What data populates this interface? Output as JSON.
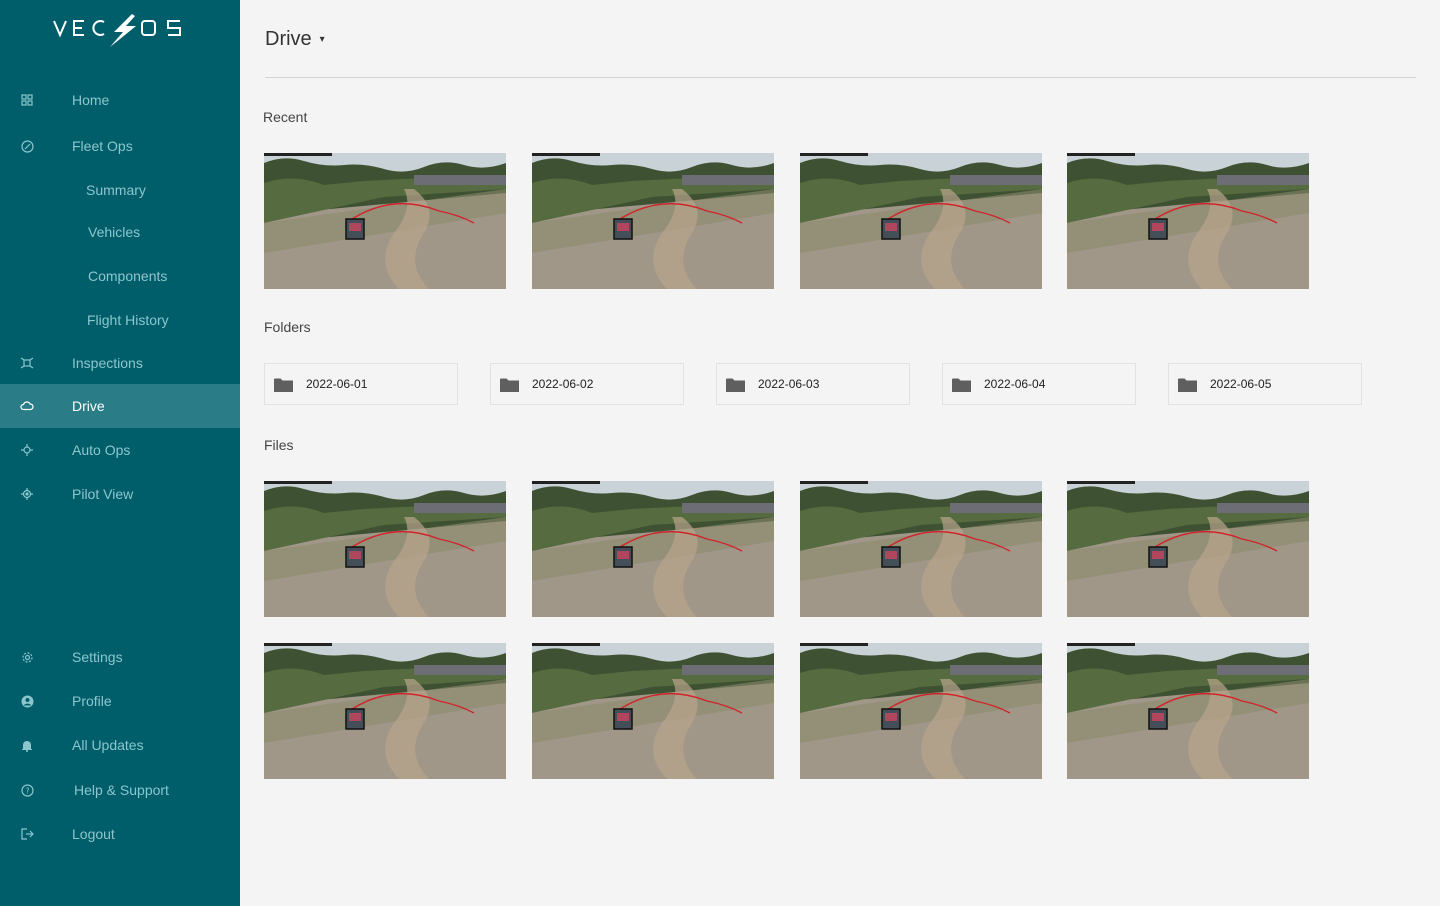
{
  "brand": {
    "logo_text": "VECTOS"
  },
  "sidebar": {
    "items": [
      {
        "key": "home",
        "label": "Home",
        "icon": "grid-icon"
      },
      {
        "key": "fleet-ops",
        "label": "Fleet Ops",
        "icon": "compass-icon"
      },
      {
        "key": "summary",
        "label": "Summary"
      },
      {
        "key": "vehicles",
        "label": "Vehicles"
      },
      {
        "key": "components",
        "label": "Components"
      },
      {
        "key": "flight-history",
        "label": "Flight History"
      },
      {
        "key": "inspections",
        "label": "Inspections",
        "icon": "drone-icon"
      },
      {
        "key": "drive",
        "label": "Drive",
        "icon": "cloud-icon",
        "active": true
      },
      {
        "key": "auto-ops",
        "label": "Auto Ops",
        "icon": "crosshair-icon"
      },
      {
        "key": "pilot-view",
        "label": "Pilot View",
        "icon": "target-icon"
      },
      {
        "key": "settings",
        "label": "Settings",
        "icon": "gear-icon"
      },
      {
        "key": "profile",
        "label": "Profile",
        "icon": "user-icon"
      },
      {
        "key": "all-updates",
        "label": "All Updates",
        "icon": "bell-icon"
      },
      {
        "key": "help",
        "label": "Help & Support",
        "icon": "help-icon"
      },
      {
        "key": "logout",
        "label": "Logout",
        "icon": "logout-icon"
      }
    ]
  },
  "header": {
    "title": "Drive",
    "caret": "▾"
  },
  "sections": {
    "recent": "Recent",
    "folders": "Folders",
    "files": "Files"
  },
  "folders": [
    "2022-06-01",
    "2022-06-02",
    "2022-06-03",
    "2022-06-04",
    "2022-06-05"
  ],
  "colors": {
    "sidebar_bg": "#005e6b",
    "sidebar_active": "#2a7c87",
    "sidebar_text": "#8cc6cd",
    "page_bg": "#f4f4f4"
  }
}
